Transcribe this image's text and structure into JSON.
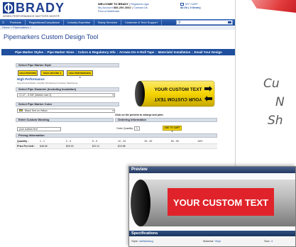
{
  "site": {
    "logo_text": "BRADY",
    "logo_tagline": "WHEN PERFORMANCE MATTERS MOST®",
    "welcome_label": "WELCOME TO BRADY",
    "register_login": "Register/Login",
    "account_label": "My Account",
    "phone": "888-250-3082",
    "contact_us": "Contact Us",
    "find_distributor": "Find a Distributor",
    "cart_label": "MY CART",
    "cart_total": "$0.00 ( 0 Items)"
  },
  "nav": {
    "items": [
      "Products",
      "Regulations/Compliance",
      "Industry Expertise",
      "Brady Services",
      "Customer & Tech Support"
    ]
  },
  "breadcrumb": {
    "text": "Home > Pipemarkers >"
  },
  "page": {
    "title": "Pipemarkers Custom Design Tool",
    "subnav": [
      "Pipe Marker Styles",
      "Pipe Marker Sizes",
      "Colors & Regulatory Info",
      "Arrows-On-A-Roll Tape",
      "Materials/ Installation",
      "Email Your Design"
    ]
  },
  "form": {
    "style_head": "Select Pipe Marker Style",
    "style_buttons": [
      "HIGH PERFORM",
      "SNAP-AROUND ➔",
      "HIGH PERFORMANCE ➔"
    ],
    "perf_title": "High Performance",
    "perf_desc": "Vinyl Around Marker. Flexible Shrinkwrap & Outdoor Weathering",
    "diameter_head": "Select Pipe Diameter (Including Insulation)",
    "diameter_value": "3 1/2\" - 5 5/8\" (Marker size 3)",
    "color_head": "Select Pipe Marker Color",
    "color_value": "Black Text on Yellow",
    "wording_head": "Enter Custom Wording",
    "wording_value": "your custom text",
    "ordering_head": "Ordering Information",
    "click_note": "Click on the preview to enlarge and print.",
    "order_qty_label": "Order Quantity:",
    "order_qty": "1",
    "add_to_cart": "ADD TO CART ➔",
    "pricing_head": "Pricing Information",
    "pricing": {
      "qty_label": "Quantity :",
      "qty": [
        "1 - 1",
        "2 - 4",
        "5 - 9",
        "10 - 24",
        "25 - 49",
        "50 - 99",
        "100+"
      ],
      "price_label": "Price Per Unit :",
      "price": [
        "$48.65",
        "$25.00",
        "$22.11",
        "$19.85",
        "",
        "",
        ""
      ]
    }
  },
  "marker": {
    "text": "YOUR CUSTOM TEXT",
    "yellow": "#f5d400",
    "black": "#111111"
  },
  "slide": {
    "lines": [
      "Cu",
      "N",
      "Sh"
    ],
    "text_color": "#5a5a5a",
    "banner_color": "#e23c3c"
  },
  "preview": {
    "title": "Preview",
    "marker_text": "YOUR CUSTOM TEXT",
    "marker_red": "#e0232a",
    "specs_title": "Specifications",
    "specs": [
      {
        "label": "Style:",
        "value": "selfsticking"
      },
      {
        "label": "Material:",
        "value": "Vinyl"
      },
      {
        "label": "Size:",
        "value": "4"
      }
    ]
  }
}
